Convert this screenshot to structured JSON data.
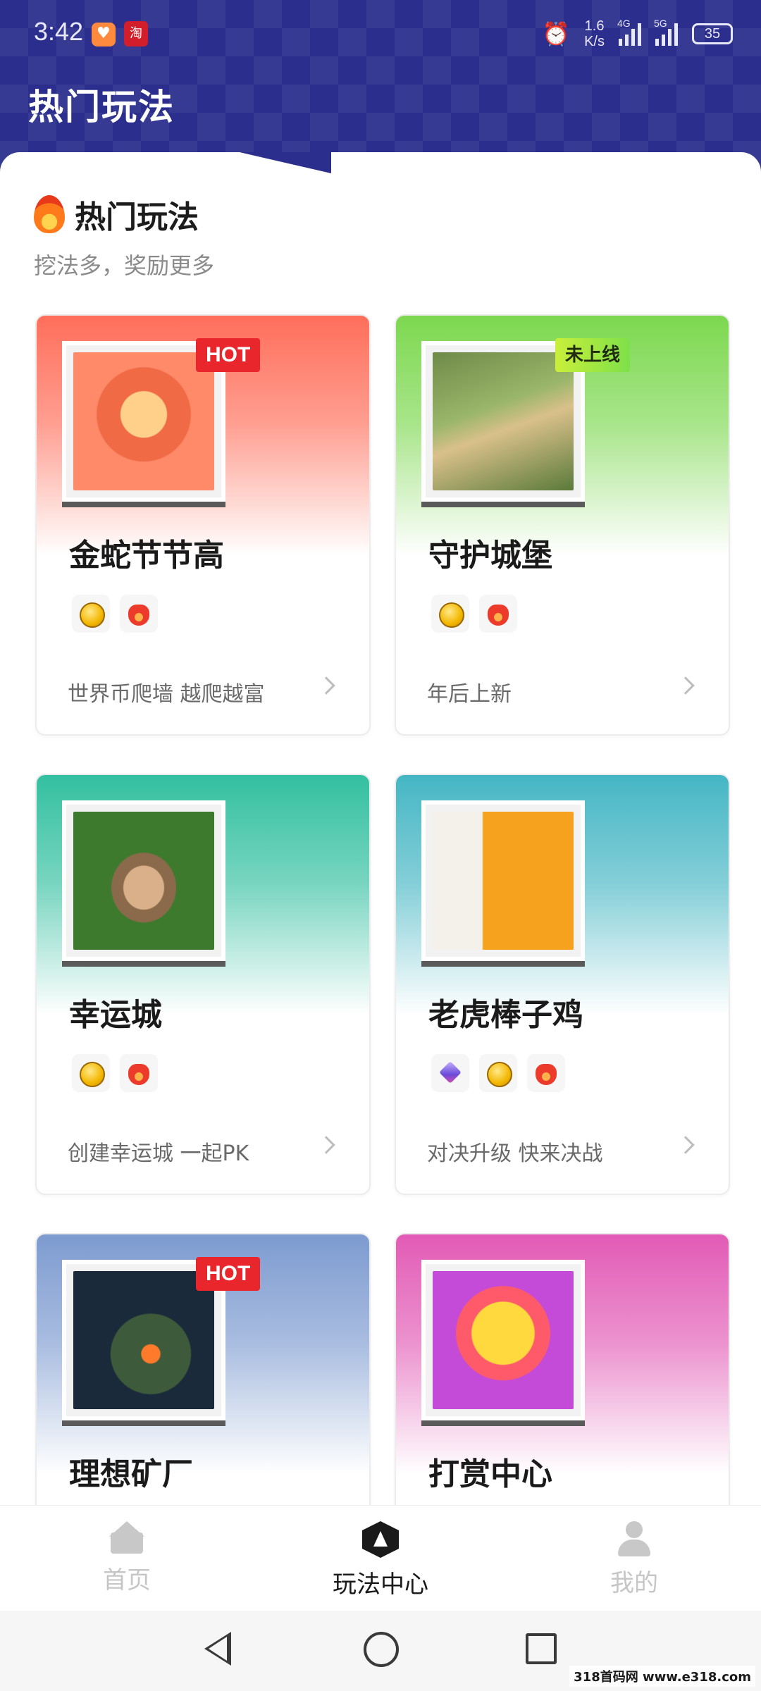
{
  "status_bar": {
    "time": "3:42",
    "app_icon_2_text": "淘",
    "net_speed_value": "1.6",
    "net_speed_unit": "K/s",
    "signal1_label": "4G",
    "signal2_label": "5G",
    "battery": "35"
  },
  "header": {
    "title": "热门玩法"
  },
  "section": {
    "title": "热门玩法",
    "subtitle": "挖法多，奖励更多"
  },
  "cards": [
    {
      "name": "金蛇节节高",
      "desc": "世界币爬墙 越爬越富",
      "badge": "HOT",
      "rewards": [
        "coin-icon",
        "bag-icon"
      ],
      "color": "#ff6e5a"
    },
    {
      "name": "守护城堡",
      "desc": "年后上新",
      "badge": "未上线",
      "rewards": [
        "coin-icon",
        "bag-icon"
      ],
      "color": "#7cd84f"
    },
    {
      "name": "幸运城",
      "desc": "创建幸运城 一起PK",
      "badge": "",
      "rewards": [
        "coin-icon",
        "bag-icon"
      ],
      "color": "#33c0a0"
    },
    {
      "name": "老虎棒子鸡",
      "desc": "对决升级 快来决战",
      "badge": "",
      "rewards": [
        "gem-icon",
        "coin-icon",
        "bag-icon"
      ],
      "color": "#45b6c4"
    },
    {
      "name": "理想矿厂",
      "desc": "",
      "badge": "HOT",
      "rewards": [],
      "color": "#7d9bd0"
    },
    {
      "name": "打赏中心",
      "desc": "",
      "badge": "",
      "rewards": [],
      "color": "#e25bb6"
    }
  ],
  "tabbar": {
    "items": [
      {
        "label": "首页",
        "icon": "home-icon",
        "active": false
      },
      {
        "label": "玩法中心",
        "icon": "play-icon",
        "active": true
      },
      {
        "label": "我的",
        "icon": "user-icon",
        "active": false
      }
    ]
  },
  "watermark": "318首码网 www.e318.com"
}
